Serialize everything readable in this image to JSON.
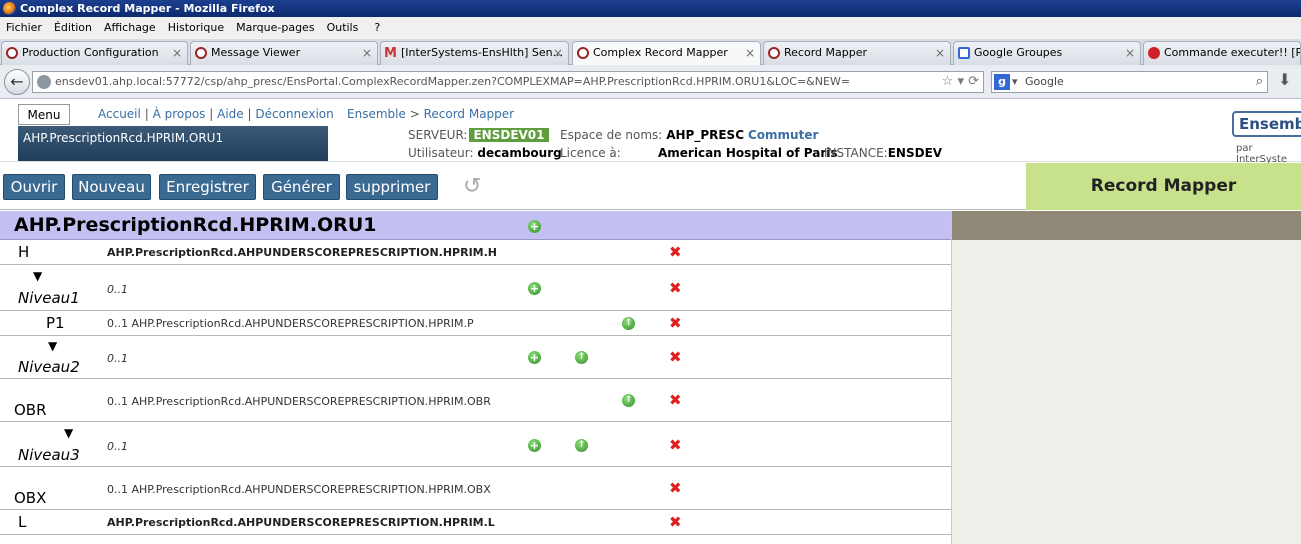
{
  "window": {
    "title": "Complex Record Mapper - Mozilla Firefox"
  },
  "menubar": [
    "Fichier",
    "Édition",
    "Affichage",
    "Historique",
    "Marque-pages",
    "Outils",
    "?"
  ],
  "tabs": [
    {
      "label": "Production Configuration"
    },
    {
      "label": "Message Viewer"
    },
    {
      "label": "[InterSystems-EnsHlth] Sen..."
    },
    {
      "label": "Complex Record Mapper"
    },
    {
      "label": "Record Mapper"
    },
    {
      "label": "Google Groupes"
    },
    {
      "label": "Commande executer!! [Réso"
    }
  ],
  "url": "ensdev01.ahp.local:57772/csp/ahp_presc/EnsPortal.ComplexRecordMapper.zen?COMPLEXMAP=AHP.PrescriptionRcd.HPRIM.ORU1&LOC=&NEW=",
  "search": {
    "engine": "Google"
  },
  "header": {
    "menu": "Menu",
    "links": [
      "Accueil",
      "À propos",
      "Aide",
      "Déconnexion"
    ],
    "breadcrumb": [
      "Ensemble",
      "Record Mapper"
    ],
    "app_name": "AHP.PrescriptionRcd.HPRIM.ORU1",
    "server_label": "SERVEUR:",
    "server": "ENSDEV01",
    "user_label": "Utilisateur:",
    "user": "decambourg",
    "ns_label": "Espace de noms:",
    "ns": "AHP_PRESC",
    "ns_switch": "Commuter",
    "license_label": "Licence à:",
    "license": "American Hospital of Paris",
    "instance_label": "INSTANCE:",
    "instance": "ENSDEV",
    "logo": "Ensemb",
    "logo_sub": "par InterSyste"
  },
  "toolbar": [
    "Ouvrir",
    "Nouveau",
    "Enregistrer",
    "Générer",
    "supprimer"
  ],
  "banner": "Record Mapper",
  "record_title": "AHP.PrescriptionRcd.HPRIM.ORU1",
  "rows": [
    {
      "name": "H",
      "text": "AHP.PrescriptionRcd.AHPUNDERSCOREPRESCRIPTION.HPRIM.H"
    },
    {
      "name": "Niveau1",
      "text": "0..1"
    },
    {
      "name": "P1",
      "text": "0..1 AHP.PrescriptionRcd.AHPUNDERSCOREPRESCRIPTION.HPRIM.P"
    },
    {
      "name": "Niveau2",
      "text": "0..1"
    },
    {
      "name": "OBR",
      "text": "0..1 AHP.PrescriptionRcd.AHPUNDERSCOREPRESCRIPTION.HPRIM.OBR"
    },
    {
      "name": "Niveau3",
      "text": "0..1"
    },
    {
      "name": "OBX",
      "text": "0..1 AHP.PrescriptionRcd.AHPUNDERSCOREPRESCRIPTION.HPRIM.OBX"
    },
    {
      "name": "L",
      "text": "AHP.PrescriptionRcd.AHPUNDERSCOREPRESCRIPTION.HPRIM.L"
    }
  ]
}
